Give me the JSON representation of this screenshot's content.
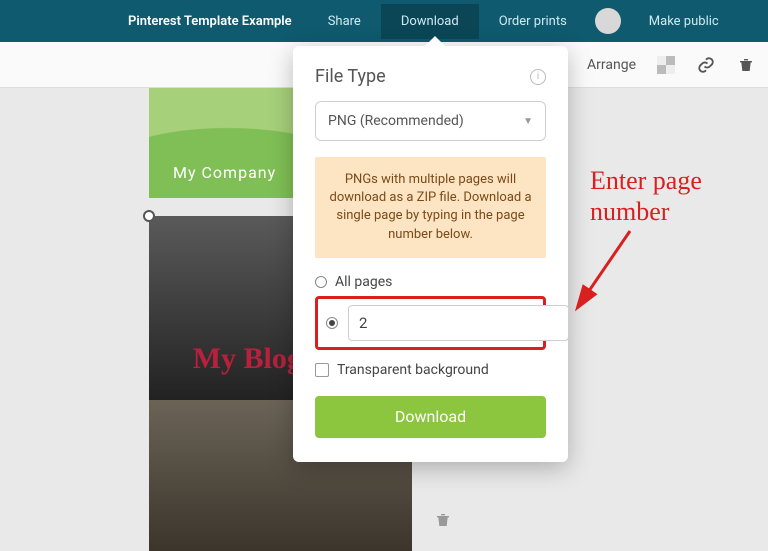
{
  "topbar": {
    "doc_title": "Pinterest Template Example",
    "share": "Share",
    "download": "Download",
    "order_prints": "Order prints",
    "make_public": "Make public"
  },
  "subbar": {
    "arrange": "Arrange"
  },
  "thumbs": {
    "company_label": "My Company",
    "blog_title": "My Blog Title"
  },
  "popover": {
    "heading": "File Type",
    "filetype_selected": "PNG (Recommended)",
    "notice": "PNGs with multiple pages will download as a ZIP file. Download a single page by typing in the page number below.",
    "all_pages_label": "All pages",
    "page_value": "2",
    "transparent_label": "Transparent background",
    "download_btn": "Download"
  },
  "annotation": {
    "text": "Enter page number"
  }
}
